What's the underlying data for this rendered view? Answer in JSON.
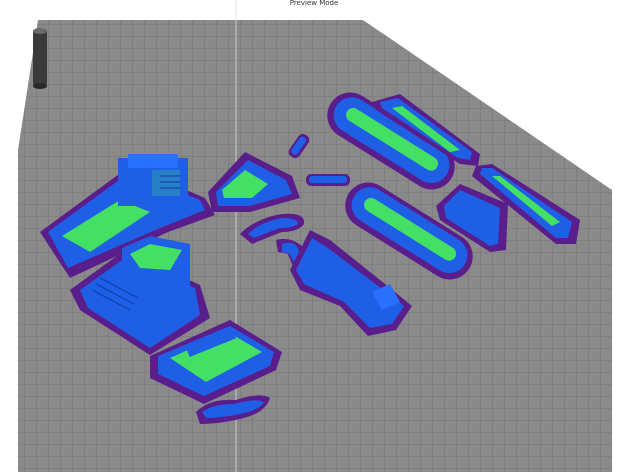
{
  "app": {
    "mode_label": "Preview Mode"
  },
  "scene": {
    "build_plate_color": "#8a8a8a",
    "grid_line_color": "#6e6e6e",
    "skirt_color": "#5a1e8c",
    "shell_color": "#1e5fe6",
    "infill_color": "#44e066",
    "background_color": "#ffffff",
    "parts": [
      "tower-column",
      "cab-body",
      "turret-block",
      "front-plate",
      "small-track-link-1",
      "small-track-link-2",
      "track-assembly-top",
      "track-assembly-bottom",
      "long-arm-top",
      "long-arm-bottom",
      "clip-piece",
      "hook-piece",
      "boom-arm",
      "bracket-piece",
      "base-panel",
      "small-clip-bottom"
    ]
  }
}
